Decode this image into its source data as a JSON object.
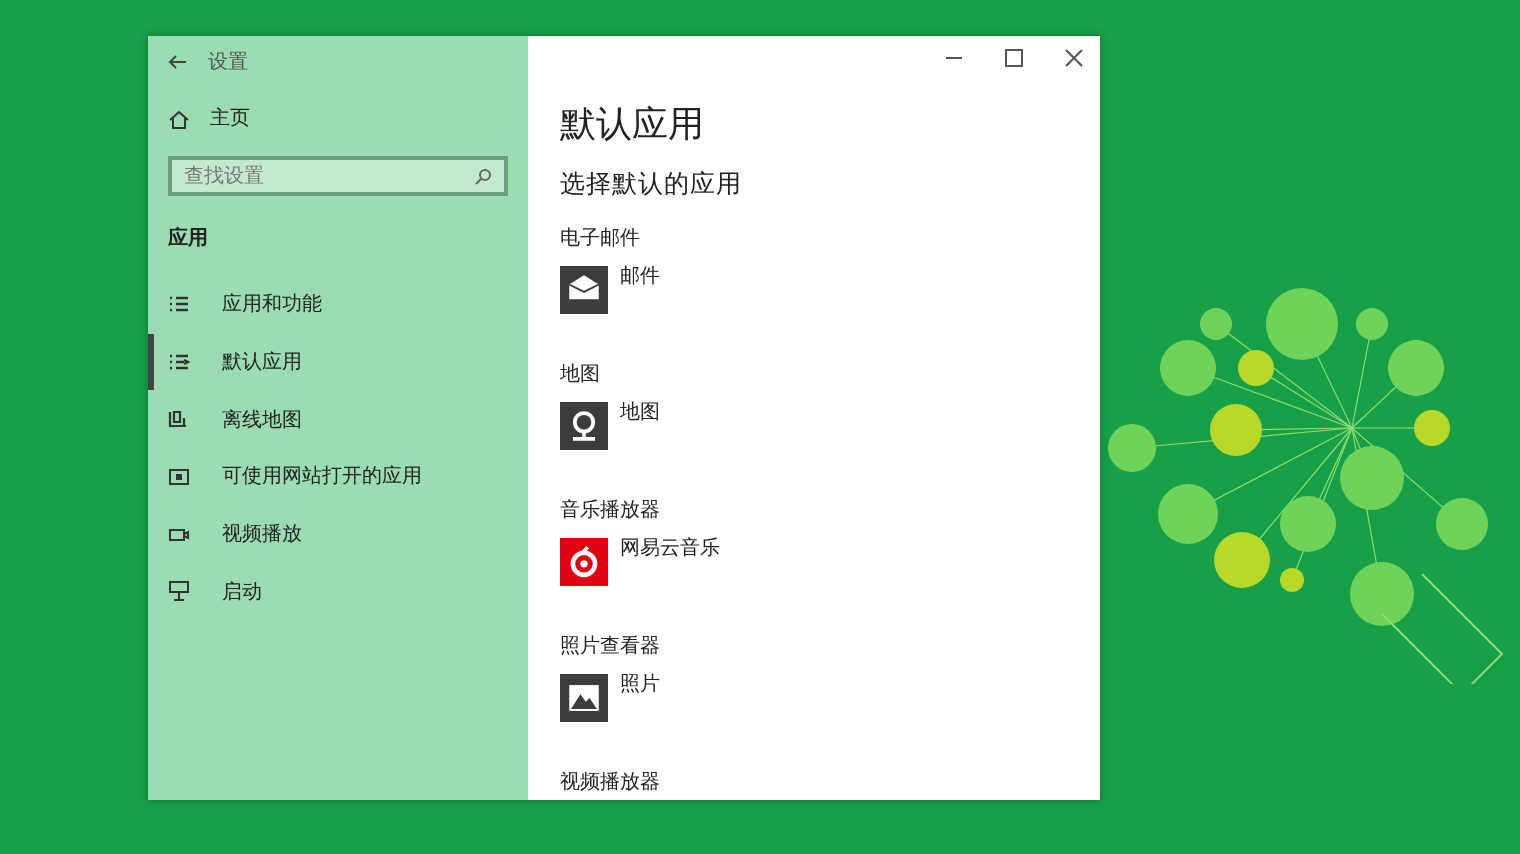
{
  "window": {
    "title": "设置"
  },
  "sidebar": {
    "home": "主页",
    "search": {
      "placeholder": "查找设置"
    },
    "section": "应用",
    "items": [
      {
        "label": "应用和功能",
        "kind": "list",
        "selected": false
      },
      {
        "label": "默认应用",
        "kind": "list-arrow",
        "selected": true
      },
      {
        "label": "离线地图",
        "kind": "map",
        "selected": false
      },
      {
        "label": "可使用网站打开的应用",
        "kind": "web",
        "selected": false
      },
      {
        "label": "视频播放",
        "kind": "video",
        "selected": false
      },
      {
        "label": "启动",
        "kind": "startup",
        "selected": false
      }
    ]
  },
  "content": {
    "title": "默认应用",
    "subtitle": "选择默认的应用",
    "categories": [
      {
        "label": "电子邮件",
        "app": {
          "name": "邮件",
          "kind": "mail"
        }
      },
      {
        "label": "地图",
        "app": {
          "name": "地图",
          "kind": "maps"
        }
      },
      {
        "label": "音乐播放器",
        "app": {
          "name": "网易云音乐",
          "kind": "music"
        }
      },
      {
        "label": "照片查看器",
        "app": {
          "name": "照片",
          "kind": "photos"
        }
      },
      {
        "label": "视频播放器"
      }
    ]
  }
}
